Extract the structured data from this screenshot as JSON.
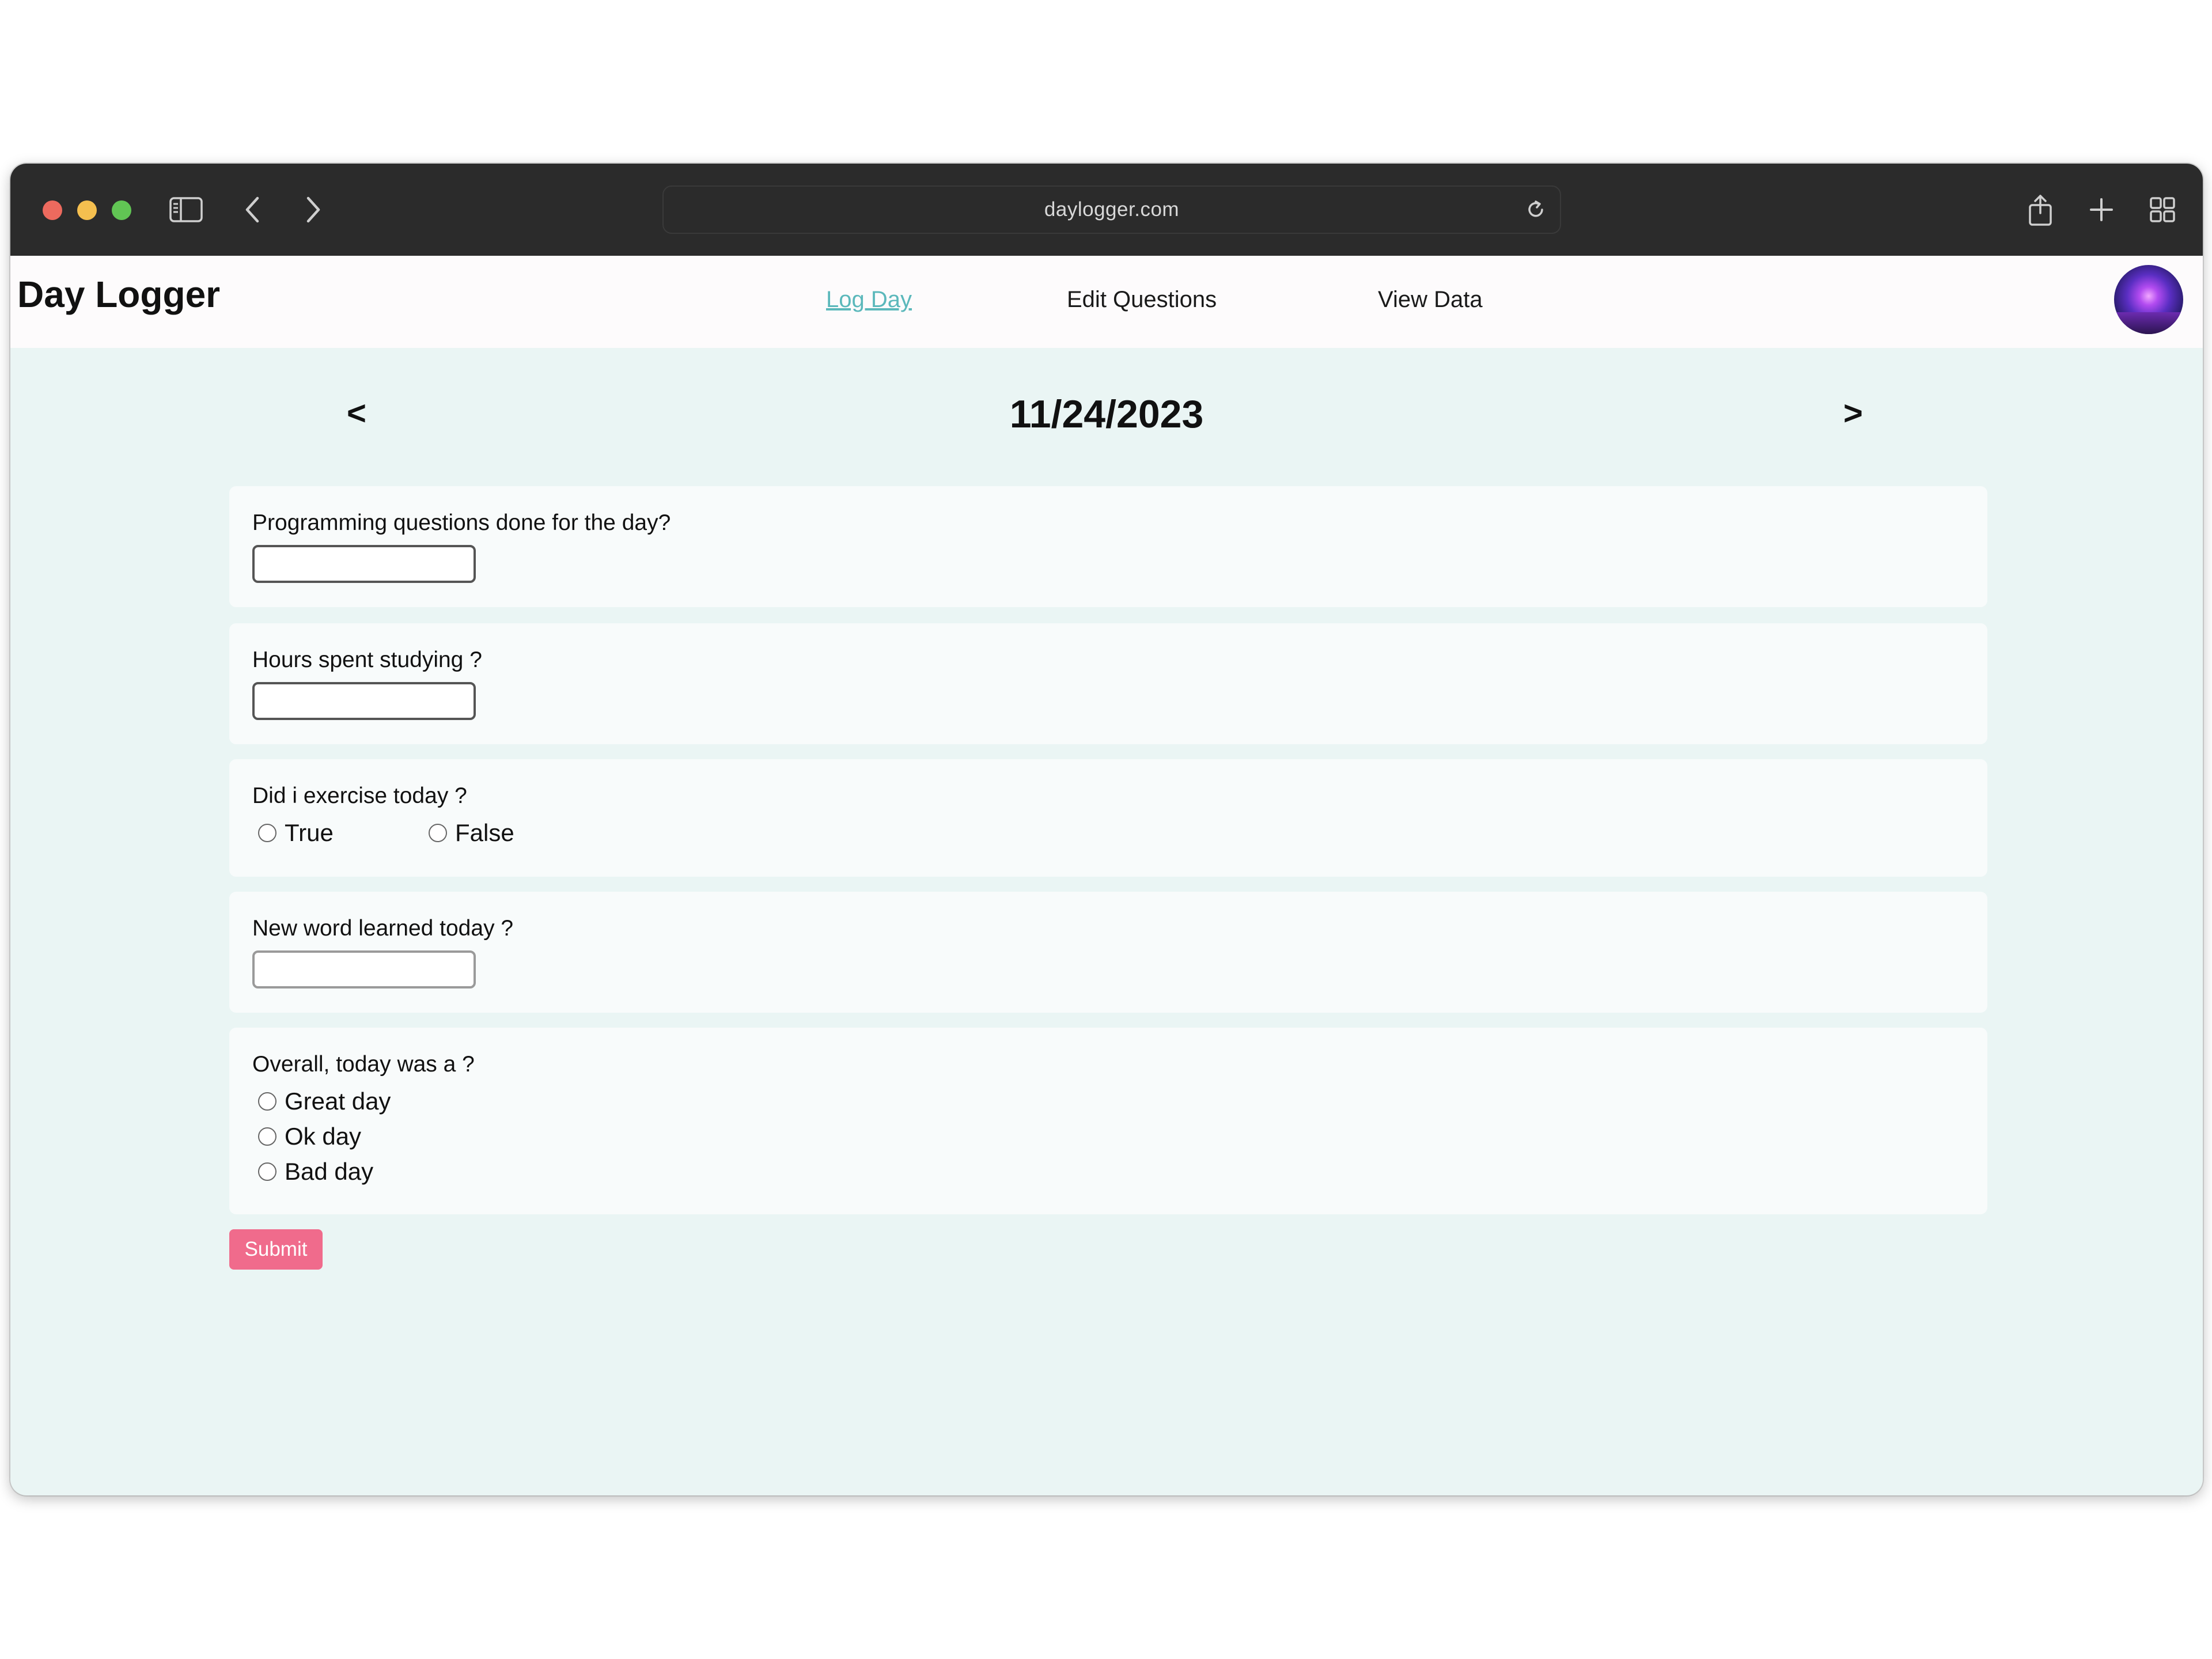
{
  "browser": {
    "url": "daylogger.com"
  },
  "app": {
    "title": "Day Logger",
    "nav": {
      "log_day": "Log Day",
      "edit_questions": "Edit Questions",
      "view_data": "View Data"
    }
  },
  "date_nav": {
    "prev": "<",
    "date": "11/24/2023",
    "next": ">"
  },
  "questions": [
    {
      "label": "Programming questions done for the day?",
      "type": "text",
      "value": ""
    },
    {
      "label": "Hours spent studying ?",
      "type": "text",
      "value": ""
    },
    {
      "label": "Did i exercise today ?",
      "type": "radio",
      "options": [
        "True",
        "False"
      ]
    },
    {
      "label": "New word learned today ?",
      "type": "text",
      "value": ""
    },
    {
      "label": "Overall, today was a ?",
      "type": "radio",
      "options": [
        "Great day",
        "Ok day",
        "Bad day"
      ]
    }
  ],
  "submit_label": "Submit",
  "colors": {
    "active_link": "#5bb8bb",
    "submit": "#f06b8c",
    "page_background": "#eaf5f4",
    "titlebar": "#2b2b2b"
  }
}
